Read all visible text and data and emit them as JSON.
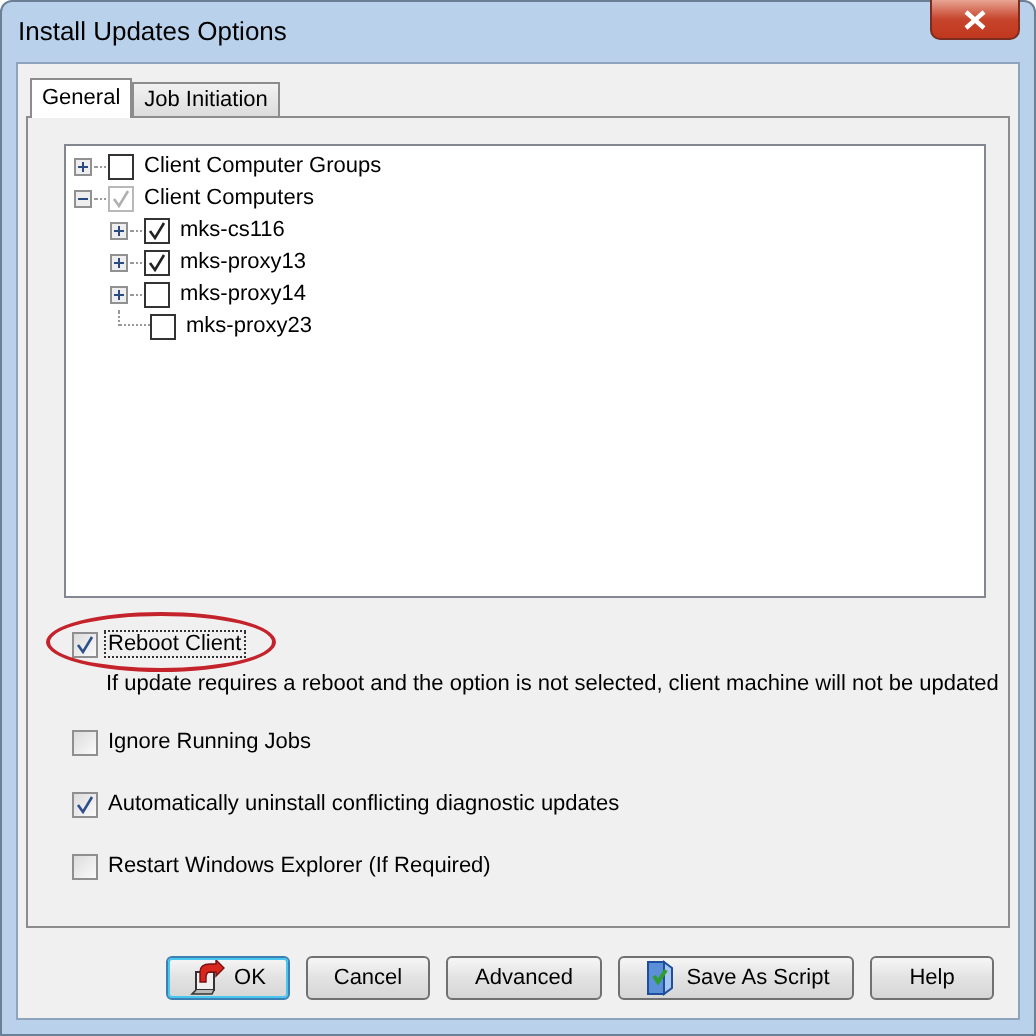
{
  "window": {
    "title": "Install Updates Options"
  },
  "tabs": [
    {
      "label": "General",
      "selected": true
    },
    {
      "label": "Job Initiation",
      "selected": false
    }
  ],
  "tree": [
    {
      "label": "Client Computer Groups",
      "checked": false,
      "disabled": false,
      "expandable": true,
      "expanded": false
    },
    {
      "label": "Client Computers",
      "checked": true,
      "disabled": true,
      "expandable": true,
      "expanded": true,
      "children": [
        {
          "label": "mks-cs116",
          "checked": true,
          "disabled": false,
          "expandable": true
        },
        {
          "label": "mks-proxy13",
          "checked": true,
          "disabled": false,
          "expandable": true
        },
        {
          "label": "mks-proxy14",
          "checked": false,
          "disabled": false,
          "expandable": true
        },
        {
          "label": "mks-proxy23",
          "checked": false,
          "disabled": false,
          "expandable": false
        }
      ]
    }
  ],
  "options": [
    {
      "label": "Reboot Client",
      "checked": true,
      "focused": true,
      "highlighted": true,
      "note": "If update requires a reboot and the option is not selected, client machine will not be updated"
    },
    {
      "label": "Ignore Running Jobs",
      "checked": false,
      "focused": false,
      "highlighted": false
    },
    {
      "label": "Automatically uninstall conflicting diagnostic updates",
      "checked": true,
      "focused": false,
      "highlighted": false
    },
    {
      "label": "Restart Windows Explorer (If Required)",
      "checked": false,
      "focused": false,
      "highlighted": false
    }
  ],
  "buttons": [
    {
      "label": "OK",
      "kind": "run",
      "default": true
    },
    {
      "label": "Cancel",
      "kind": "plain",
      "default": false
    },
    {
      "label": "Advanced",
      "kind": "plain",
      "default": false
    },
    {
      "label": "Save As Script",
      "kind": "script",
      "default": false
    },
    {
      "label": "Help",
      "kind": "plain",
      "default": false
    }
  ]
}
